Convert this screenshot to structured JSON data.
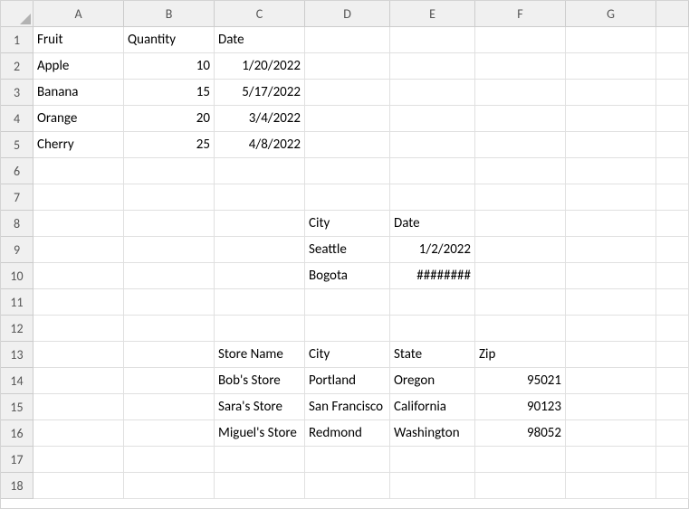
{
  "columns": [
    "A",
    "B",
    "C",
    "D",
    "E",
    "F",
    "G"
  ],
  "rows": [
    "1",
    "2",
    "3",
    "4",
    "5",
    "6",
    "7",
    "8",
    "9",
    "10",
    "11",
    "12",
    "13",
    "14",
    "15",
    "16",
    "17",
    "18"
  ],
  "cells": {
    "A1": {
      "v": "Fruit",
      "a": "txt"
    },
    "B1": {
      "v": "Quantity",
      "a": "txt"
    },
    "C1": {
      "v": "Date",
      "a": "txt"
    },
    "A2": {
      "v": "Apple",
      "a": "txt"
    },
    "B2": {
      "v": "10",
      "a": "num"
    },
    "C2": {
      "v": "1/20/2022",
      "a": "num"
    },
    "A3": {
      "v": "Banana",
      "a": "txt"
    },
    "B3": {
      "v": "15",
      "a": "num"
    },
    "C3": {
      "v": "5/17/2022",
      "a": "num"
    },
    "A4": {
      "v": "Orange",
      "a": "txt"
    },
    "B4": {
      "v": "20",
      "a": "num"
    },
    "C4": {
      "v": "3/4/2022",
      "a": "num"
    },
    "A5": {
      "v": "Cherry",
      "a": "txt"
    },
    "B5": {
      "v": "25",
      "a": "num"
    },
    "C5": {
      "v": "4/8/2022",
      "a": "num"
    },
    "D8": {
      "v": "City",
      "a": "txt"
    },
    "E8": {
      "v": "Date",
      "a": "txt"
    },
    "D9": {
      "v": "Seattle",
      "a": "txt"
    },
    "E9": {
      "v": "1/2/2022",
      "a": "num"
    },
    "D10": {
      "v": "Bogota",
      "a": "txt"
    },
    "E10": {
      "v": "########",
      "a": "num"
    },
    "C13": {
      "v": "Store Name",
      "a": "txt"
    },
    "D13": {
      "v": "City",
      "a": "txt"
    },
    "E13": {
      "v": "State",
      "a": "txt"
    },
    "F13": {
      "v": "Zip",
      "a": "txt"
    },
    "C14": {
      "v": "Bob's Store",
      "a": "txt"
    },
    "D14": {
      "v": "Portland",
      "a": "txt"
    },
    "E14": {
      "v": "Oregon",
      "a": "txt"
    },
    "F14": {
      "v": "95021",
      "a": "num"
    },
    "C15": {
      "v": "Sara's Store",
      "a": "txt"
    },
    "D15": {
      "v": "San Francisco",
      "a": "txt"
    },
    "E15": {
      "v": "California",
      "a": "txt"
    },
    "F15": {
      "v": "90123",
      "a": "num"
    },
    "C16": {
      "v": "Miguel's Store",
      "a": "txt"
    },
    "D16": {
      "v": "Redmond",
      "a": "txt"
    },
    "E16": {
      "v": "Washington",
      "a": "txt"
    },
    "F16": {
      "v": "98052",
      "a": "num"
    }
  }
}
